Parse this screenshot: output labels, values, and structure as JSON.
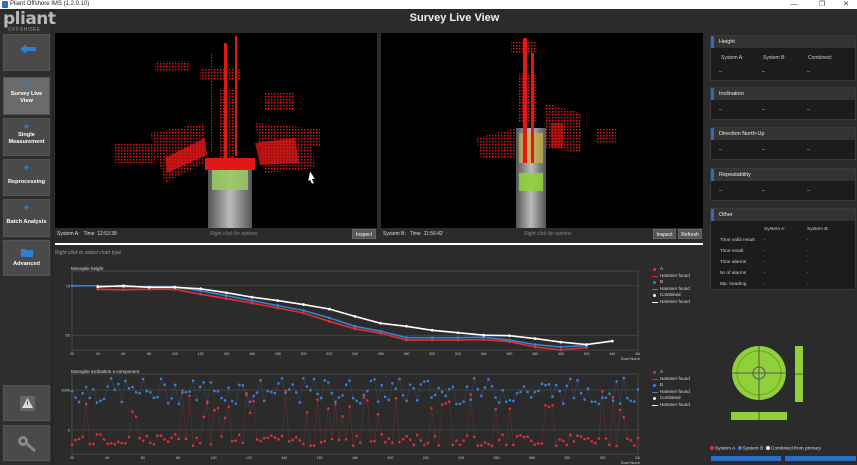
{
  "window": {
    "title": "Pliant Offshore IMS (1.2.0.10)",
    "min": "—",
    "max": "❐",
    "close": "✕"
  },
  "logo": {
    "main": "pliant",
    "sub": "OFFSHORE"
  },
  "page_title": "Survey Live View",
  "nav": [
    {
      "label": "Survey Live View",
      "active": true
    },
    {
      "label": "Single Measurement",
      "active": false
    },
    {
      "label": "Reprocessing",
      "active": false
    },
    {
      "label": "Batch Analysis",
      "active": false
    },
    {
      "label": "Advanced",
      "active": false
    }
  ],
  "view_a": {
    "system_label": "System A:",
    "time_label": "Time",
    "time": "12:53:39",
    "hint": "Right click for options",
    "inspect": "Inspect"
  },
  "view_b": {
    "system_label": "System B:",
    "time_label": "Time",
    "time": "11:56:42",
    "hint": "Right click for options",
    "inspect": "Inspect",
    "refresh": "Refresh"
  },
  "chart_hint": "Right click to select chart type",
  "panels": {
    "height": {
      "title": "Height",
      "col_a": "System A:",
      "col_b": "System B:",
      "col_c": "Combined:",
      "vals": [
        "–",
        "–",
        "–"
      ]
    },
    "inclination": {
      "title": "Inclination",
      "vals": [
        "–",
        "–",
        "–"
      ]
    },
    "direction": {
      "title": "Direction North-Up",
      "vals": [
        "–",
        "–",
        "–"
      ]
    },
    "repeatability": {
      "title": "Repeatability",
      "vals": [
        "–",
        "–",
        "–"
      ]
    },
    "other": {
      "title": "Other",
      "col_a": "System A:",
      "col_b": "System B:",
      "rows": [
        {
          "label": "Time valid result",
          "a": "-",
          "b": "-"
        },
        {
          "label": "Time result",
          "a": "-",
          "b": "-"
        },
        {
          "label": "Time alarms",
          "a": "-",
          "b": "-"
        },
        {
          "label": "Nr of alarms",
          "a": "-",
          "b": "-"
        },
        {
          "label": "Mp. heading",
          "a": "-",
          "b": "-"
        }
      ]
    }
  },
  "bottom_legend": {
    "a": "System A",
    "b": "System B",
    "c": "Combined from primary"
  },
  "colors": {
    "accent": "#2b6cc4",
    "red": "#e03030",
    "blue": "#3a7fd8",
    "white": "#ffffff",
    "gauge": "#8fd13a"
  },
  "chart_data": [
    {
      "type": "scatter",
      "title": "Monopile height",
      "xlabel": "Scan Number",
      "ylabel": "",
      "xlim": [
        20,
        460
      ],
      "ylim": [
        62,
        78
      ],
      "x_ticks": [
        20,
        40,
        60,
        80,
        100,
        120,
        140,
        160,
        180,
        200,
        220,
        240,
        260,
        280,
        300,
        320,
        340,
        360,
        380,
        400,
        420,
        440,
        460
      ],
      "y_ticks": [
        65,
        75
      ],
      "series": [
        {
          "name": "A",
          "color": "#e03030",
          "x": [
            40,
            60,
            80,
            100,
            120,
            140,
            160,
            180,
            200,
            220,
            240,
            260,
            280,
            300,
            320,
            340,
            360,
            380,
            400,
            420
          ],
          "values": [
            74.3,
            74.2,
            74.3,
            74.3,
            73.3,
            72.4,
            71.5,
            70.5,
            69.5,
            67.8,
            66.3,
            65.4,
            64.0,
            64.0,
            64.0,
            64.1,
            63.7,
            62.6,
            62.0,
            62.5
          ]
        },
        {
          "name": "B",
          "color": "#3a7fd8",
          "x": [
            20,
            40,
            60,
            80,
            100,
            120,
            140,
            160,
            180,
            200,
            220,
            240,
            260,
            280,
            300,
            320,
            340,
            360,
            380,
            400,
            420
          ],
          "values": [
            75.0,
            75.0,
            74.8,
            74.8,
            74.8,
            74.0,
            73.0,
            72.0,
            71.0,
            70.0,
            68.5,
            66.8,
            65.8,
            64.5,
            64.5,
            64.5,
            64.6,
            64.0,
            63.1,
            62.6,
            62.9
          ]
        },
        {
          "name": "Combined",
          "color": "#ffffff",
          "x": [
            40,
            60,
            80,
            100,
            120,
            140,
            160,
            180,
            200,
            220,
            240,
            260,
            280,
            300,
            320,
            340,
            360,
            380,
            400,
            420,
            440
          ],
          "values": [
            74.8,
            75.0,
            74.7,
            74.7,
            74.4,
            73.6,
            72.7,
            72.0,
            71.2,
            70.3,
            68.8,
            67.4,
            66.8,
            66.0,
            65.5,
            65.0,
            64.9,
            64.3,
            63.6,
            63.1,
            63.8
          ]
        }
      ],
      "legend": [
        "A",
        "Hammer found",
        "B",
        "Hammer found",
        "Combined",
        "Hammer found"
      ]
    },
    {
      "type": "scatter",
      "title": "Monopile inclination x-component",
      "xlabel": "Scan Number",
      "ylabel": "",
      "xlim": [
        20,
        340
      ],
      "ylim": [
        -600,
        1400
      ],
      "x_ticks": [
        20,
        40,
        60,
        80,
        100,
        120,
        140,
        160,
        180,
        200,
        220,
        240,
        260,
        280,
        300,
        320,
        340
      ],
      "y_ticks": [
        0,
        1000
      ],
      "series": [
        {
          "name": "A",
          "color": "#e03030",
          "note": "scattered points between about -400 and 1000, mostly near -300"
        },
        {
          "name": "B",
          "color": "#3a7fd8",
          "note": "scattered points mostly between 600 and 1300"
        }
      ],
      "legend": [
        "A",
        "Hammer found",
        "B",
        "Hammer found",
        "Combined",
        "Hammer found"
      ]
    }
  ]
}
